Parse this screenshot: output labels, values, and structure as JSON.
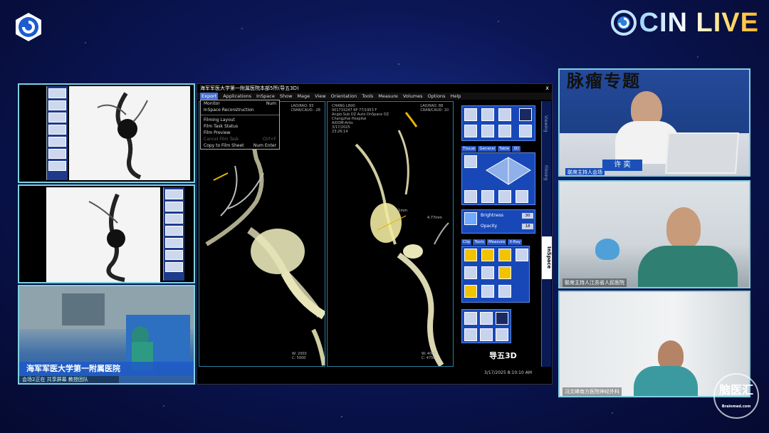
{
  "brand": {
    "name": "CIN LIVE",
    "prefix_icon": "cin-logo-icon"
  },
  "app": {
    "title": "海军军医大学第一附属医院本部5所(导五3D)",
    "close_label": "x",
    "menu": [
      "Export",
      "Applications",
      "InSpace",
      "Show",
      "Mage",
      "View",
      "Orientation",
      "Tools",
      "Measure",
      "Volumes",
      "Options",
      "Help"
    ],
    "dropdown": [
      {
        "label": "Monitor",
        "key": "Num"
      },
      {
        "label": "InSpace Reconstruction",
        "key": ""
      },
      {
        "label": "Filming Layout",
        "key": ""
      },
      {
        "label": "Film Task Status",
        "key": ""
      },
      {
        "label": "Film Preview",
        "key": ""
      },
      {
        "label": "Cancel Film Task",
        "key": "Ctrl+F"
      },
      {
        "label": "Copy to Film Sheet",
        "key": "Num Enter"
      }
    ],
    "view1_meta": "LAO/RAO: 83\nCRAN/CAUD: -28",
    "view2_meta_left": "CHANG LINXI\n001733247 6P 77/1953 F\nAngio Sub DZ Auto DnSpace DZ\nChangzhai Hospital\nAXIOM-Artis\n3/17/2025\n23:26:14",
    "view2_meta_right": "LAO/RAO: 88\nCRAN/CAUD: 10",
    "view1_wl": "W: 2000\nC: 5000",
    "view2_wl": "W: 4000\nC: 4750",
    "tabs_top": [
      "Tissue",
      "General",
      "Table",
      "3D"
    ],
    "tabs_bottom": [
      "Clip",
      "Tools",
      "Measure",
      "X-Ray"
    ],
    "brightness_label": "Brightness",
    "brightness_value": "30",
    "opacity_label": "Opacity",
    "opacity_value": "18",
    "side_tab": "InSpace",
    "side_tab_labels": [
      "Viewing",
      "Filming"
    ],
    "daowu": "导五3D",
    "datetime": "3/17/2025 8:10:10 AM",
    "annotation_a": "11mm",
    "annotation_b": "4.77mm"
  },
  "or_caption": "海军军医大学第一附属医院",
  "or_sub": "会场2正在 共享屏幕  教授团队",
  "cams": [
    {
      "topic": "脉瘤专题",
      "name": "许 奕",
      "label": "联席主持人会场"
    },
    {
      "label": "联席主持人江苏省人民医院"
    },
    {
      "label": "冯文峰南方医院神经外科"
    }
  ],
  "watermark": {
    "title": "脑医汇",
    "sub": "Brainmed.com"
  }
}
